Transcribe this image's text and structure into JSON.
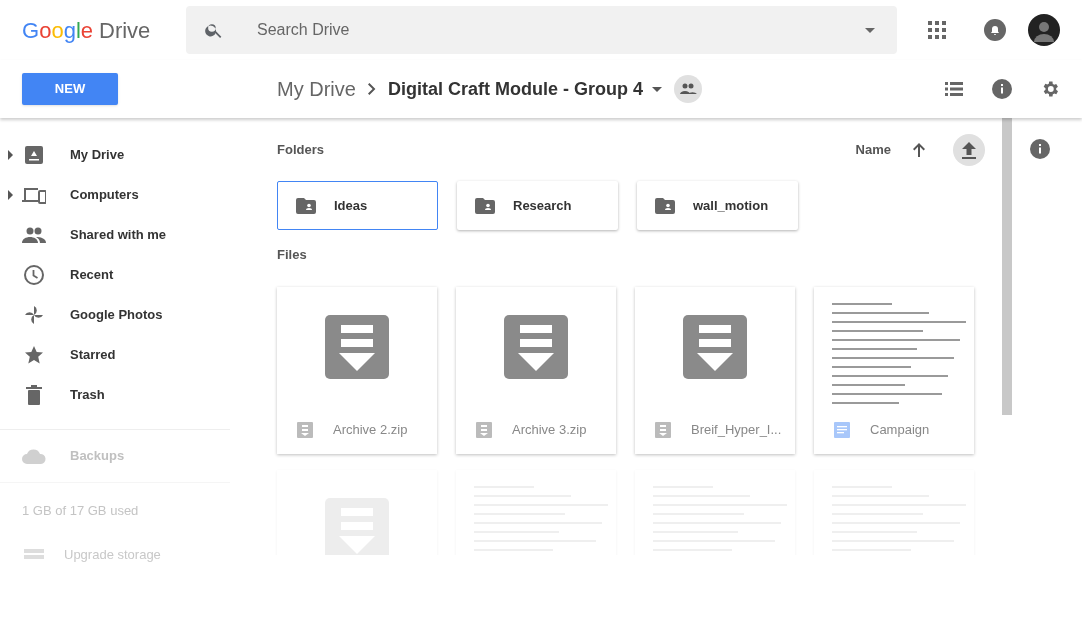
{
  "header": {
    "logo": {
      "brand": "Google",
      "product": "Drive"
    },
    "search": {
      "placeholder": "Search Drive"
    }
  },
  "new_button": "NEW",
  "breadcrumb": [
    "My Drive",
    "Digital Craft Module - Group 4"
  ],
  "sidebar": {
    "items": [
      {
        "label": "My Drive",
        "expandable": true
      },
      {
        "label": "Computers",
        "expandable": true
      },
      {
        "label": "Shared with me",
        "expandable": false
      },
      {
        "label": "Recent",
        "expandable": false
      },
      {
        "label": "Google Photos",
        "expandable": false
      },
      {
        "label": "Starred",
        "expandable": false
      },
      {
        "label": "Trash",
        "expandable": false
      }
    ],
    "backups": "Backups",
    "storage": "1 GB of 17 GB used",
    "upgrade": "Upgrade storage"
  },
  "folders_label": "Folders",
  "sort": {
    "label": "Name"
  },
  "files_label": "Files",
  "folders": [
    {
      "name": "Ideas",
      "selected": true
    },
    {
      "name": "Research",
      "selected": false
    },
    {
      "name": "wall_motion",
      "selected": false
    }
  ],
  "files": [
    {
      "name": "Archive 2.zip",
      "kind": "zip"
    },
    {
      "name": "Archive 3.zip",
      "kind": "zip"
    },
    {
      "name": "Breif_Hyper_I...",
      "kind": "zip"
    },
    {
      "name": "Campaign",
      "kind": "doc"
    }
  ],
  "more_files": [
    {
      "kind": "zip"
    },
    {
      "kind": "doc"
    },
    {
      "kind": "doc"
    },
    {
      "kind": "doc"
    }
  ]
}
